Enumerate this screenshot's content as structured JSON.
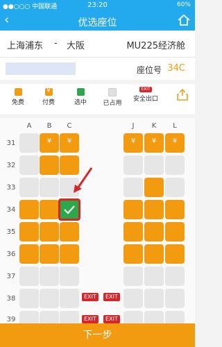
{
  "status_bar": {
    "carrier": "●●○○○ 中国联通",
    "time": "23:20",
    "battery": "60%"
  },
  "nav": {
    "title": "优选座位",
    "back_icon": "back-chevron-icon",
    "home_icon": "home-icon"
  },
  "route": {
    "from": "上海浦东",
    "separator": "-",
    "to": "大阪",
    "flight": "MU225经济舱"
  },
  "passenger": {
    "seat_label": "座位号",
    "seat_value": "34C"
  },
  "legend": {
    "items": [
      {
        "label": "免费",
        "type": "free"
      },
      {
        "label": "付费",
        "type": "paid"
      },
      {
        "label": "选中",
        "type": "selected"
      },
      {
        "label": "已占用",
        "type": "occupied"
      },
      {
        "label": "安全出口",
        "type": "exit",
        "badge": "EXIT"
      }
    ]
  },
  "seatmap": {
    "columns": [
      "A",
      "B",
      "C",
      "J",
      "K",
      "L"
    ],
    "rows": [
      "31",
      "32",
      "33",
      "34",
      "35",
      "36",
      "37",
      "38",
      "39"
    ],
    "exit_label": "EXIT",
    "paid_symbol": "¥"
  },
  "footer": {
    "next_label": "下一步"
  },
  "colors": {
    "accent": "#22a9ee",
    "free": "#f29b11",
    "selected": "#2aa84a",
    "exit": "#d7262b"
  }
}
